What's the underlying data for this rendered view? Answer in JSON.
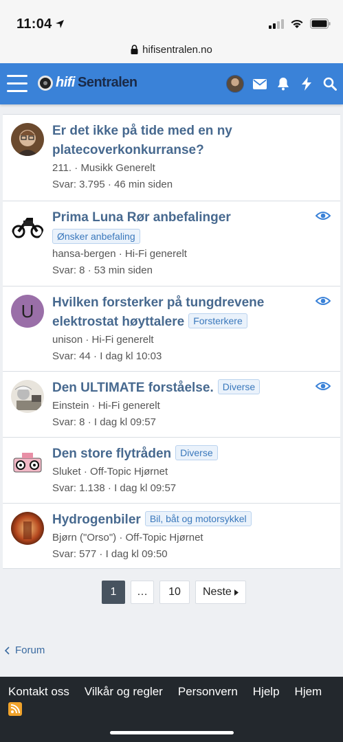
{
  "status_bar": {
    "time": "11:04"
  },
  "url_bar": {
    "domain": "hifisentralen.no"
  },
  "navbar": {
    "logo_part1": "hifi",
    "logo_part2": "Sentralen",
    "brand_color": "#3a82d8"
  },
  "threads": [
    {
      "title": "Er det ikke på tide med en ny platecoverkonkurranse?",
      "prefix": "",
      "author": "211.",
      "forum": "Musikk Generelt",
      "replies": "Svar: 3.795",
      "time": "46 min siden",
      "watched": false
    },
    {
      "title": "Prima Luna Rør anbefalinger",
      "prefix": "Ønsker anbefaling",
      "author": "hansa-bergen",
      "forum": "Hi-Fi generelt",
      "replies": "Svar: 8",
      "time": "53 min siden",
      "watched": true
    },
    {
      "title": "Hvilken forsterker på tungdrevene elektrostat høyttalere",
      "prefix": "Forsterkere",
      "author": "unison",
      "forum": "Hi-Fi generelt",
      "replies": "Svar: 44",
      "time": "I dag kl 10:03",
      "watched": true,
      "avatar_letter": "U"
    },
    {
      "title": "Den ULTIMATE forståelse.",
      "prefix": "Diverse",
      "author": "Einstein",
      "forum": "Hi-Fi generelt",
      "replies": "Svar: 8",
      "time": "I dag kl 09:57",
      "watched": true
    },
    {
      "title": "Den store flytråden",
      "prefix": "Diverse",
      "author": "Sluket",
      "forum": "Off-Topic Hjørnet",
      "replies": "Svar: 1.138",
      "time": "I dag kl 09:57",
      "watched": false
    },
    {
      "title": "Hydrogenbiler",
      "prefix": "Bil, båt og motorsykkel",
      "author": "Bjørn (\"Orso\")",
      "forum": "Off-Topic Hjørnet",
      "replies": "Svar: 577",
      "time": "I dag kl 09:50",
      "watched": false
    }
  ],
  "pagination": {
    "current": "1",
    "ellipsis": "…",
    "last": "10",
    "next": "Neste"
  },
  "breadcrumb": {
    "label": "Forum"
  },
  "footer": {
    "links": [
      "Kontakt oss",
      "Vilkår og regler",
      "Personvern",
      "Hjelp",
      "Hjem"
    ]
  }
}
